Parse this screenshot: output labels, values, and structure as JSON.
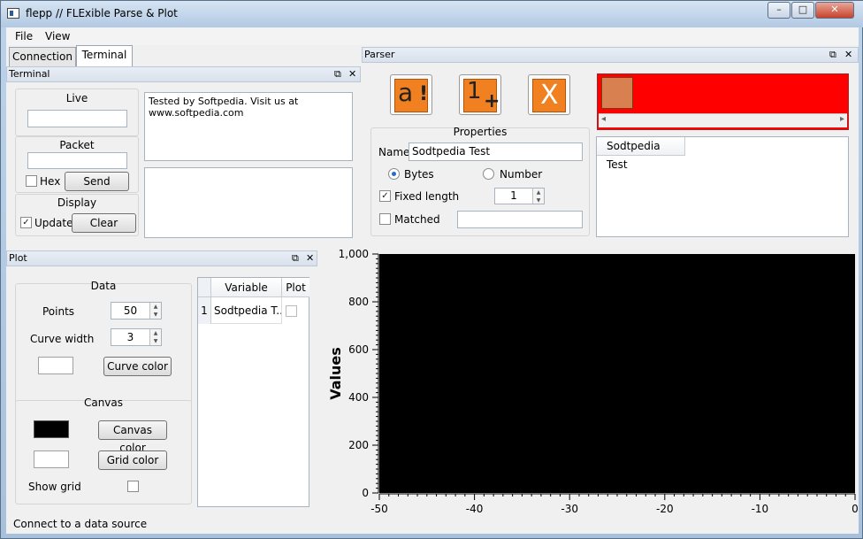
{
  "window": {
    "title": "flepp // FLExible Parse & Plot",
    "min": "–",
    "max": "□",
    "close": "✕"
  },
  "menu": {
    "file": "File",
    "view": "View"
  },
  "tabs": [
    {
      "label": "Connection"
    },
    {
      "label": "Terminal"
    }
  ],
  "terminal": {
    "header": "Terminal",
    "live_label": "Live",
    "live_value": "",
    "packet_label": "Packet",
    "packet_value": "",
    "hex_label": "Hex",
    "send_label": "Send",
    "display_label": "Display",
    "update_label": "Update",
    "clear_label": "Clear",
    "output_text": "Tested by Softpedia. Visit us at www.softpedia.com",
    "input_text": ""
  },
  "parser": {
    "header": "Parser",
    "properties_label": "Properties",
    "name_label": "Name",
    "name_value": "Sodtpedia Test",
    "bytes_label": "Bytes",
    "number_label": "Number",
    "fixed_length_label": "Fixed length",
    "fixed_length_value": "1",
    "matched_label": "Matched",
    "matched_value": "",
    "list_header": "Sodtpedia Test",
    "scroll_left": "◂",
    "scroll_right": "▸"
  },
  "plot": {
    "header": "Plot",
    "data_label": "Data",
    "points_label": "Points",
    "points_value": "50",
    "curve_width_label": "Curve width",
    "curve_width_value": "3",
    "curve_color_label": "Curve color",
    "canvas_label": "Canvas",
    "canvas_color_label": "Canvas color",
    "grid_color_label": "Grid color",
    "show_grid_label": "Show grid",
    "table": {
      "col_variable": "Variable",
      "col_plot": "Plot",
      "rows": [
        {
          "index": "1",
          "variable": "Sodtpedia T..."
        }
      ]
    }
  },
  "status": "Connect to a data source",
  "colors": {
    "accent_red": "#ff0000",
    "tool_orange": "#f08020",
    "canvas": "#000000"
  },
  "icons": [
    "window-app-icon",
    "insert-text-icon",
    "insert-number-icon",
    "delete-icon",
    "float-icon",
    "close-icon"
  ],
  "chart_data": {
    "type": "line",
    "ylabel": "Values",
    "xlabel": "",
    "xlim": [
      -50,
      0
    ],
    "ylim": [
      0,
      1000
    ],
    "xticks": [
      "-50",
      "-40",
      "-30",
      "-20",
      "-10",
      "0"
    ],
    "yticks": [
      "1,000",
      "800",
      "600",
      "400",
      "200",
      "0"
    ],
    "series": [],
    "background": "#000000",
    "grid": false
  }
}
